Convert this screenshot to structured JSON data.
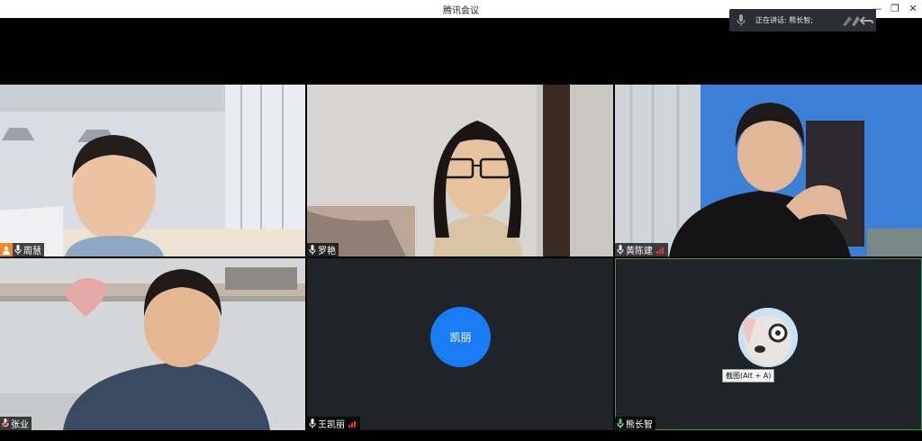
{
  "window": {
    "title": "腾讯会议"
  },
  "speaking": {
    "label": "正在讲话: 熊长智;"
  },
  "participants": [
    {
      "name": "周慧",
      "host": true,
      "signal": false
    },
    {
      "name": "罗艳",
      "host": false,
      "signal": false
    },
    {
      "name": "黄陈建",
      "host": false,
      "signal": true
    },
    {
      "name": "张业",
      "host": false,
      "signal": false
    },
    {
      "name": "王凯丽",
      "host": false,
      "signal": true,
      "avatar_text": "凯丽",
      "avatar_color": "#1a7cf5"
    },
    {
      "name": "熊长智",
      "host": false,
      "signal": false,
      "active_speaker": true,
      "avatar_tooltip": "截图(Alt + A)"
    }
  ],
  "colors": {
    "active_border": "#2e9e5a",
    "avatar_blue": "#1a7cf5",
    "host_badge": "#f08a24",
    "tile_bg": "#202327"
  }
}
